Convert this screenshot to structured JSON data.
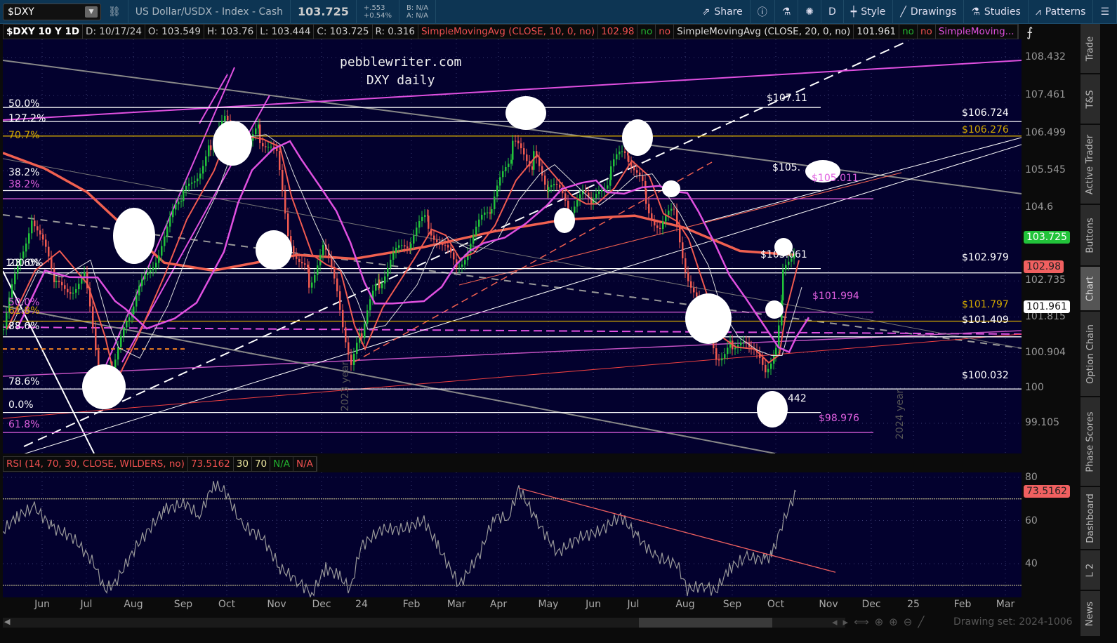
{
  "topbar": {
    "symbol": "$DXY",
    "description": "US Dollar/USDX - Index - Cash",
    "last": "103.725",
    "change": "+.553",
    "change_pct": "+0.54%",
    "bid": "B: N/A",
    "ask": "A: N/A",
    "tools": [
      {
        "label": "Share",
        "icon": "share-icon"
      },
      {
        "label": "",
        "icon": "info-icon"
      },
      {
        "label": "",
        "icon": "flask-icon"
      },
      {
        "label": "",
        "icon": "gear-icon"
      },
      {
        "label": "D",
        "icon": ""
      },
      {
        "label": "Style",
        "icon": "candle-icon"
      },
      {
        "label": "Drawings",
        "icon": "pen-icon"
      },
      {
        "label": "Studies",
        "icon": "flask-icon"
      },
      {
        "label": "Patterns",
        "icon": "patterns-icon"
      },
      {
        "label": "",
        "icon": "menu-icon"
      }
    ]
  },
  "infoline": {
    "title": "$DXY 10 Y 1D",
    "d": "D: 10/17/24",
    "o": "O: 103.549",
    "h": "H: 103.76",
    "l": "L: 103.444",
    "c": "C: 103.725",
    "r": "R: 0.316",
    "sma10": "SimpleMovingAvg (CLOSE, 10, 0, no)",
    "sma10_val": "102.98",
    "no1": "no",
    "no2": "no",
    "sma20": "SimpleMovingAvg (CLOSE, 20, 0, no)",
    "sma20_val": "101.961",
    "no3": "no",
    "no4": "no",
    "sma3": "SimpleMoving..."
  },
  "watermark": {
    "line1": "pebblewriter.com",
    "line2": "DXY daily"
  },
  "fib_labels": [
    {
      "t": "50.0%",
      "c": "#ffffff"
    },
    {
      "t": "127.2%",
      "c": "#ffffff"
    },
    {
      "t": "70.7%",
      "c": "#d4a900"
    },
    {
      "t": "38.2%",
      "c": "#ffffff"
    },
    {
      "t": "38.2%",
      "c": "#e060e0"
    },
    {
      "t": "23.6%",
      "c": "#ffffff"
    },
    {
      "t": "100.0%",
      "c": "#ffffff"
    },
    {
      "t": "50.0%",
      "c": "#e060e0"
    },
    {
      "t": "61.8%",
      "c": "#d4a900"
    },
    {
      "t": "88.6%",
      "c": "#ffffff"
    },
    {
      "t": "78.6%",
      "c": "#ffffff"
    },
    {
      "t": "0.0%",
      "c": "#ffffff"
    },
    {
      "t": "61.8%",
      "c": "#e060e0"
    }
  ],
  "price_labels": [
    {
      "t": "$107.11",
      "c": "#ffffff"
    },
    {
      "t": "$106.724",
      "c": "#ffffff"
    },
    {
      "t": "$106.276",
      "c": "#d4a900"
    },
    {
      "t": "$105.",
      "c": "#ffffff"
    },
    {
      "t": "$105.011",
      "c": "#e060e0"
    },
    {
      "t": "$103.061",
      "c": "#ffffff"
    },
    {
      "t": "$102.979",
      "c": "#ffffff"
    },
    {
      "t": "$101.994",
      "c": "#e060e0"
    },
    {
      "t": "$101.797",
      "c": "#d4a900"
    },
    {
      "t": "$101.409",
      "c": "#ffffff"
    },
    {
      "t": "$100.032",
      "c": "#ffffff"
    },
    {
      "t": "442",
      "c": "#ffffff"
    },
    {
      "t": "$98.976",
      "c": "#e060e0"
    }
  ],
  "year_labels": [
    "2023 year",
    "2024 year"
  ],
  "price_axis": [
    "108.432",
    "107.461",
    "106.499",
    "105.545",
    "104.6",
    "102.735",
    "101.815",
    "100.904",
    "100",
    "99.105"
  ],
  "badges": {
    "last": "103.725",
    "sma10": "102.98",
    "sma20": "101.961",
    "colors": {
      "last": "#22c33a",
      "sma10": "#f06060",
      "sma20": "#ffffff"
    }
  },
  "rsi": {
    "title": "RSI (14, 70, 30, CLOSE, WILDERS, no)",
    "value": "73.5162",
    "ob": "30",
    "os": "70",
    "na1": "N/A",
    "na2": "N/A",
    "axis": [
      "80",
      "60",
      "40"
    ]
  },
  "time_axis": [
    "Jun",
    "Jul",
    "Aug",
    "Sep",
    "Oct",
    "Nov",
    "Dec",
    "24",
    "Feb",
    "Mar",
    "Apr",
    "May",
    "Jun",
    "Jul",
    "Aug",
    "Sep",
    "Oct",
    "Nov",
    "Dec",
    "25",
    "Feb",
    "Mar"
  ],
  "bottom": {
    "drawing_set": "Drawing set: 2024-1006"
  },
  "side_tabs": [
    "Trade",
    "T&S",
    "Active Trader",
    "Buttons",
    "Chart",
    "Option Chain",
    "Phase Scores",
    "Dashboard",
    "L 2",
    "News"
  ],
  "chart_data": {
    "type": "line",
    "title": "$DXY 10 Y 1D",
    "ylim": [
      98.7,
      109.0
    ],
    "close": [
      [
        0,
        101.5
      ],
      [
        40,
        104.5
      ],
      [
        75,
        102.5
      ],
      [
        115,
        102.8
      ],
      [
        140,
        99.8
      ],
      [
        155,
        100.5
      ],
      [
        185,
        102
      ],
      [
        225,
        103.8
      ],
      [
        256,
        104.8
      ],
      [
        295,
        106.3
      ],
      [
        315,
        106.7
      ],
      [
        335,
        106.2
      ],
      [
        365,
        106.5
      ],
      [
        389,
        105.8
      ],
      [
        405,
        104
      ],
      [
        435,
        102.8
      ],
      [
        455,
        103.5
      ],
      [
        475,
        102.5
      ],
      [
        495,
        100.7
      ],
      [
        510,
        101.3
      ],
      [
        535,
        102.8
      ],
      [
        580,
        103.8
      ],
      [
        605,
        104.3
      ],
      [
        625,
        103.5
      ],
      [
        645,
        103.1
      ],
      [
        665,
        103.8
      ],
      [
        695,
        104.5
      ],
      [
        725,
        106.1
      ],
      [
        755,
        105.8
      ],
      [
        776,
        105.2
      ],
      [
        805,
        104.6
      ],
      [
        825,
        104.8
      ],
      [
        840,
        104.6
      ],
      [
        865,
        105.6
      ],
      [
        890,
        106
      ],
      [
        915,
        104.8
      ],
      [
        935,
        104.1
      ],
      [
        955,
        104.4
      ],
      [
        971,
        103.2
      ],
      [
        995,
        101.8
      ],
      [
        1015,
        100.9
      ],
      [
        1038,
        101.2
      ],
      [
        1065,
        100.8
      ],
      [
        1085,
        100.5
      ],
      [
        1100,
        101.2
      ],
      [
        1110,
        102.8
      ],
      [
        1128,
        103.725
      ]
    ],
    "sma200": [
      [
        0,
        106.0
      ],
      [
        60,
        105.6
      ],
      [
        120,
        105.0
      ],
      [
        180,
        104.0
      ],
      [
        230,
        103.2
      ],
      [
        300,
        103.0
      ],
      [
        360,
        103.2
      ],
      [
        420,
        103.4
      ],
      [
        500,
        103.3
      ],
      [
        600,
        103.6
      ],
      [
        700,
        104.0
      ],
      [
        800,
        104.3
      ],
      [
        900,
        104.4
      ],
      [
        970,
        104.1
      ],
      [
        1050,
        103.5
      ],
      [
        1128,
        103.4
      ]
    ],
    "hlines": [
      {
        "p": 107.16,
        "c": "#ffffff",
        "x2": 1165
      },
      {
        "p": 106.8,
        "c": "#ffffff",
        "x2": 1451
      },
      {
        "p": 106.43,
        "c": "#d4a900",
        "x2": 1451
      },
      {
        "p": 105.04,
        "c": "#ffffff",
        "x2": 1165
      },
      {
        "p": 104.83,
        "c": "#e060e0",
        "x2": 1240
      },
      {
        "p": 103.05,
        "c": "#ffffff",
        "x2": 1165
      },
      {
        "p": 102.94,
        "c": "#ffffff",
        "x2": 1451
      },
      {
        "p": 101.94,
        "c": "#e060e0",
        "x2": 1240
      },
      {
        "p": 101.71,
        "c": "#d4a900",
        "x2": 1451
      },
      {
        "p": 101.31,
        "c": "#ffffff",
        "x2": 1451
      },
      {
        "p": 99.98,
        "c": "#ffffff",
        "x2": 1451
      },
      {
        "p": 99.38,
        "c": "#ffffff",
        "x2": 1165
      },
      {
        "p": 98.87,
        "c": "#e060e0",
        "x2": 1240
      }
    ],
    "rsi": [
      [
        0,
        55
      ],
      [
        20,
        62
      ],
      [
        45,
        66
      ],
      [
        70,
        57
      ],
      [
        100,
        52
      ],
      [
        130,
        40
      ],
      [
        145,
        28
      ],
      [
        160,
        31
      ],
      [
        190,
        48
      ],
      [
        230,
        65
      ],
      [
        260,
        68
      ],
      [
        280,
        62
      ],
      [
        300,
        77
      ],
      [
        318,
        73
      ],
      [
        340,
        58
      ],
      [
        370,
        52
      ],
      [
        395,
        38
      ],
      [
        420,
        32
      ],
      [
        440,
        26
      ],
      [
        460,
        38
      ],
      [
        480,
        34
      ],
      [
        495,
        28
      ],
      [
        510,
        48
      ],
      [
        540,
        56
      ],
      [
        570,
        56
      ],
      [
        600,
        60
      ],
      [
        620,
        48
      ],
      [
        650,
        30
      ],
      [
        680,
        45
      ],
      [
        700,
        62
      ],
      [
        720,
        61
      ],
      [
        735,
        75
      ],
      [
        760,
        60
      ],
      [
        790,
        45
      ],
      [
        820,
        52
      ],
      [
        850,
        55
      ],
      [
        880,
        62
      ],
      [
        905,
        52
      ],
      [
        930,
        43
      ],
      [
        960,
        40
      ],
      [
        975,
        28
      ],
      [
        1000,
        30
      ],
      [
        1015,
        27
      ],
      [
        1035,
        38
      ],
      [
        1060,
        43
      ],
      [
        1085,
        42
      ],
      [
        1095,
        44
      ],
      [
        1110,
        58
      ],
      [
        1130,
        73.5
      ]
    ]
  }
}
